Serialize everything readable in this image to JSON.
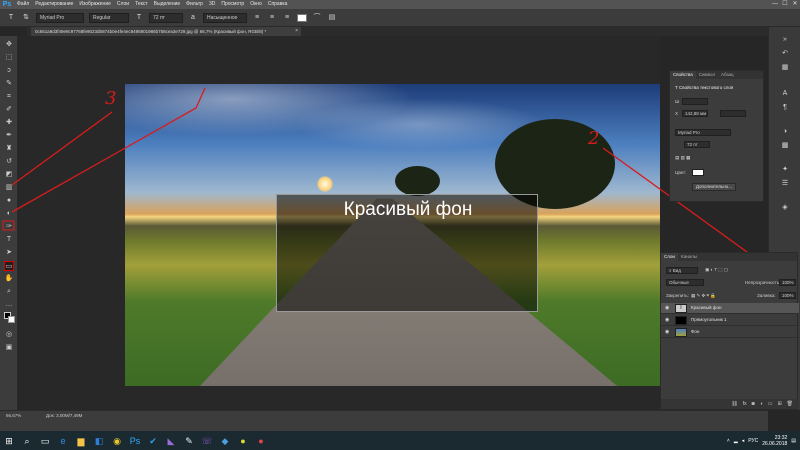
{
  "app": {
    "logo": "Ps"
  },
  "menu": {
    "items": [
      "Файл",
      "Редактирование",
      "Изображение",
      "Слои",
      "Текст",
      "Выделение",
      "Фильтр",
      "3D",
      "Просмотр",
      "Окно",
      "Справка"
    ]
  },
  "window_controls": [
    "—",
    "☐",
    "✕"
  ],
  "options": {
    "font_family": "Myriad Pro",
    "font_style": "Regular",
    "font_size": "72 пт",
    "antialias": "Насыщенное"
  },
  "document": {
    "tab_title": "0c651a9d3f49e9c97768fe9023d5874b0e4fe4ec9495901986b758cea3e729.jpg @ 66,7% (Красивый фон, RGB/8) *"
  },
  "canvas": {
    "text": "Красивый фон"
  },
  "annotations": {
    "n1": "3",
    "n2": "2"
  },
  "properties": {
    "tabs": [
      "Свойства",
      "Символ",
      "Абзац"
    ],
    "title": "Свойства текстового слоя",
    "w_label": "Ш",
    "x_label": "X",
    "x_value": "142,88 мм",
    "font": "Myriad Pro",
    "size": "72 пт",
    "color_label": "Цвет:",
    "advanced_button": "Дополнительно..."
  },
  "layers": {
    "tabs": [
      "Слои",
      "Каналы"
    ],
    "filter": "Вид",
    "blend_mode": "Обычные",
    "opacity_label": "Непрозрачность:",
    "opacity_value": "100%",
    "lock_label": "Закрепить:",
    "fill_label": "Заливка:",
    "fill_value": "100%",
    "items": [
      {
        "name": "Красивый фон",
        "thumb": "T",
        "selected": true
      },
      {
        "name": "Прямоугольник 1",
        "thumb": "",
        "selected": false
      },
      {
        "name": "Фон",
        "thumb": "",
        "selected": false
      }
    ]
  },
  "status": {
    "zoom": "66,67%",
    "doc_size": "Док: 3,00М/7,49М"
  },
  "taskbar": {
    "lang": "РУС",
    "time": "23:32",
    "date": "26.06.2018"
  },
  "colors": {
    "accent_ps": "#31a8ff",
    "annotation": "#d81c1c"
  }
}
